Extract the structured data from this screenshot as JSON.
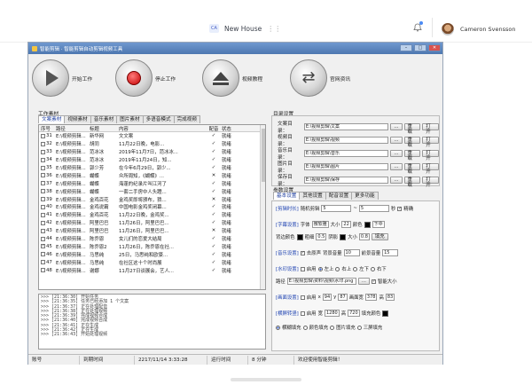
{
  "workspace": {
    "avatar": "CA",
    "name": "New House"
  },
  "user": {
    "name": "Cameron Svensson"
  },
  "app": {
    "title": "智能剪辑 · 智能剪辑自动剪辑视频工具",
    "toolbar": [
      {
        "label": "开始工作"
      },
      {
        "label": "停止工作"
      },
      {
        "label": "视频教程"
      },
      {
        "label": "官网资讯"
      }
    ],
    "material_label": "工作素材",
    "tabs": [
      "文案素材",
      "视频素材",
      "音乐素材",
      "图片素材",
      "多语音模式",
      "完成视频"
    ],
    "columns": [
      "序号",
      "路径",
      "标题",
      "内容",
      "配音",
      "状态"
    ],
    "rows": [
      {
        "n": "31",
        "path": "E:\\视频剪辑...",
        "title": "新华网",
        "content": "文文案",
        "dub": "✓",
        "status": "就绪",
        "checked": false
      },
      {
        "n": "32",
        "path": "E:\\视频剪辑...",
        "title": "胡同",
        "content": "11月22日晚，电影...",
        "dub": "✓",
        "status": "就绪",
        "checked": false
      },
      {
        "n": "33",
        "path": "E:\\视频剪辑...",
        "title": "范冰冰",
        "content": "2019年11月7日，范冰冰...",
        "dub": "✓",
        "status": "就绪",
        "checked": false
      },
      {
        "n": "34",
        "path": "E:\\视频剪辑...",
        "title": "范冰冰",
        "content": "2019年11月24日，知...",
        "dub": "✓",
        "status": "就绪",
        "checked": false
      },
      {
        "n": "35",
        "path": "E:\\视频剪辑...",
        "title": "郭少芳",
        "content": "在今年6月29日，郭少...",
        "dub": "✓",
        "status": "就绪",
        "checked": false
      },
      {
        "n": "36",
        "path": "E:\\视频剪辑...",
        "title": "蝴蝶",
        "content": "众所周知，《蝴蝶》...",
        "dub": "✕",
        "status": "就绪",
        "checked": false
      },
      {
        "n": "37",
        "path": "E:\\视频剪辑...",
        "title": "蝴蝶",
        "content": "海蓬的纪录片叫江河了",
        "dub": "✓",
        "status": "就绪",
        "checked": false
      },
      {
        "n": "38",
        "path": "E:\\视频剪辑...",
        "title": "蝴蝶",
        "content": "一套二手房中人头蹬...",
        "dub": "✓",
        "status": "就绪",
        "checked": false
      },
      {
        "n": "39",
        "path": "E:\\视频剪辑...",
        "title": "金鸡百花",
        "content": "金鸡奖即将颁布，猜...",
        "dub": "✕",
        "status": "就绪",
        "checked": false
      },
      {
        "n": "40",
        "path": "E:\\视频剪辑...",
        "title": "金鸡说霸",
        "content": "中国电影金鸡奖闭幕...",
        "dub": "✓",
        "status": "就绪",
        "checked": false
      },
      {
        "n": "41",
        "path": "E:\\视频剪辑...",
        "title": "金鸡百花",
        "content": "11月22日晚，金鸡奖...",
        "dub": "✓",
        "status": "就绪",
        "checked": false
      },
      {
        "n": "42",
        "path": "E:\\视频剪辑...",
        "title": "阿里巴巴",
        "content": "11月26日，阿里巴巴...",
        "dub": "✓",
        "status": "就绪",
        "checked": false
      },
      {
        "n": "43",
        "path": "E:\\视频剪辑...",
        "title": "阿里巴巴",
        "content": "11月26日，阿里巴巴...",
        "dub": "✕",
        "status": "就绪",
        "checked": false
      },
      {
        "n": "44",
        "path": "E:\\视频剪辑...",
        "title": "陈乔恩",
        "content": "女儿们的恋爱大结局",
        "dub": "✓",
        "status": "就绪",
        "checked": false
      },
      {
        "n": "45",
        "path": "E:\\视频剪辑...",
        "title": "陈乔恩2",
        "content": "11月26日，陈乔恩在社...",
        "dub": "✓",
        "status": "就绪",
        "checked": true
      },
      {
        "n": "46",
        "path": "E:\\视频剪辑...",
        "title": "马思纯",
        "content": "25日，马思纯和欧豪...",
        "dub": "✓",
        "status": "就绪",
        "checked": false
      },
      {
        "n": "47",
        "path": "E:\\视频剪辑...",
        "title": "马思纯",
        "content": "在社区这十个时尚展",
        "dub": "✓",
        "status": "就绪",
        "checked": false
      },
      {
        "n": "48",
        "path": "E:\\视频剪辑...",
        "title": "谢娜",
        "content": "11月27日谈展会，艺人...",
        "dub": "✓",
        "status": "就绪",
        "checked": false
      }
    ],
    "log": [
      ">>> [21:36:30] 开始任务",
      ">>> [21:36:35] 任务已经添加 1 个文案",
      ">>> [21:36:37] 正在处理配音",
      ">>> [21:36:38] 正在处理视频",
      ">>> [21:36:39] 完成视频合成",
      ">>> [21:36:40] 完成视频合成",
      ">>> [21:36:41] 正在生成",
      ">>> [21:36:42] 正在生成",
      ">>> [21:36:43] 开始处理视频"
    ],
    "dir_title": "目录设置",
    "dirs": [
      {
        "label": "文案目录：",
        "value": "E:\\视频剪辑\\文案"
      },
      {
        "label": "视频目录：",
        "value": "E:\\视频剪辑\\视频"
      },
      {
        "label": "音乐目录：",
        "value": "E:\\视频剪辑\\音乐"
      },
      {
        "label": "图片目录：",
        "value": "E:\\视频剪辑\\图片"
      },
      {
        "label": "保存目录：",
        "value": "E:\\视频剪辑\\保存"
      }
    ],
    "dir_btns": {
      "browse": "...",
      "reset": "重载",
      "open": "打开"
    },
    "param_title": "参数设置",
    "param_tabs": [
      "基本设置",
      "其他设置",
      "配音设置",
      "更多功能"
    ],
    "params": {
      "clip": {
        "label": "[剪辑时长]",
        "text": "随机剪辑",
        "a": "5",
        "sep": "~",
        "b": "5",
        "unit": "秒",
        "check": "精确"
      },
      "subtitle": {
        "label": "[字幕设置]",
        "font_l": "字体",
        "font": "微软雅",
        "size_l": "大小",
        "size": "22",
        "color_l": "颜色",
        "pos": "下中"
      },
      "subtitle2": {
        "bg_l": "背边颜色",
        "width_l": "粗细",
        "width": "0.5",
        "shadow_l": "阴影",
        "size_l": "大小",
        "size": "0.8",
        "fill": "填充"
      },
      "music": {
        "label": "[音乐设置]",
        "check": "去原声",
        "vol_l": "背景音量",
        "vol": "10",
        "front_l": "前景音量",
        "front": "15"
      },
      "wm": {
        "label": "[水印设置]",
        "enable": "启用",
        "left": "左上",
        "rt": "右上",
        "lb": "左下",
        "rb": "右下"
      },
      "wm2": {
        "path_l": "路径",
        "path": "E:\\视频剪辑\\资料\\视频\\水印.png",
        "btn": "...",
        "check": "智能大小"
      },
      "screen": {
        "label": "[画面设置]",
        "enable": "启用",
        "x_l": "x",
        "x": "94",
        "y_l": "y",
        "y": "87",
        "area_l": "画面宽",
        "w": "378",
        "h_l": "高",
        "h": "83"
      },
      "sizes": {
        "label": "[横屏转竖]",
        "enable": "启用",
        "w_l": "宽",
        "w": "1280",
        "h_l": "高",
        "h": "720",
        "fill_l": "填充颜色"
      },
      "mode": {
        "m1": "横糊填充",
        "m2": "颜色填充",
        "m3": "图片填充",
        "m4": "三屏填充"
      }
    },
    "status": [
      "账号",
      "到期时间",
      "2217/11/14 3:33:28",
      "运行时间",
      "8 分钟",
      "欢迎使用智能剪辑！"
    ]
  }
}
